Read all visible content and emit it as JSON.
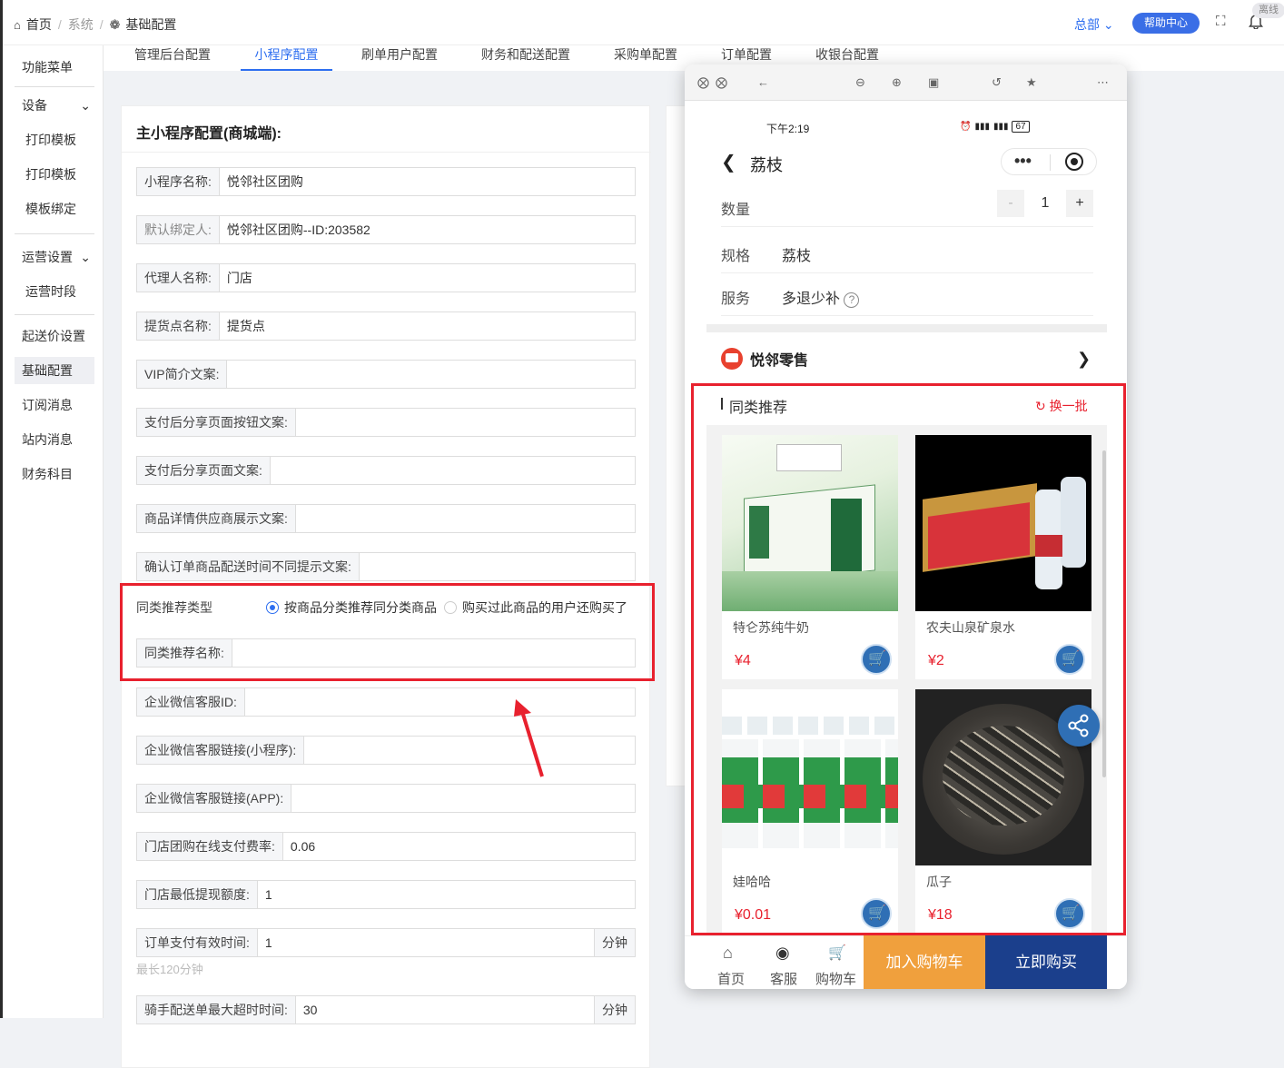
{
  "breadcrumb": {
    "home": "首页",
    "system": "系统",
    "current": "基础配置"
  },
  "header": {
    "branch": "总部",
    "help": "帮助中心",
    "status": "离线"
  },
  "sidebar": {
    "items": [
      {
        "label": "功能菜单"
      },
      {
        "label": "设备"
      },
      {
        "label": "打印模板"
      },
      {
        "label": "打印模板"
      },
      {
        "label": "模板绑定"
      },
      {
        "label": "运营设置"
      },
      {
        "label": "运营时段"
      },
      {
        "label": "起送价设置"
      },
      {
        "label": "基础配置"
      },
      {
        "label": "订阅消息"
      },
      {
        "label": "站内消息"
      },
      {
        "label": "财务科目"
      }
    ]
  },
  "tabs": [
    "管理后台配置",
    "小程序配置",
    "刷单用户配置",
    "财务和配送配置",
    "采购单配置",
    "订单配置",
    "收银台配置"
  ],
  "panel": {
    "title": "主小程序配置(商城端):",
    "fields": [
      {
        "label": "小程序名称:",
        "value": "悦邻社区团购"
      },
      {
        "label": "默认绑定人:",
        "value": "悦邻社区团购--ID:203582"
      },
      {
        "label": "代理人名称:",
        "value": "门店"
      },
      {
        "label": "提货点名称:",
        "value": "提货点"
      },
      {
        "label": "VIP简介文案:",
        "value": ""
      },
      {
        "label": "支付后分享页面按钮文案:",
        "value": ""
      },
      {
        "label": "支付后分享页面文案:",
        "value": ""
      },
      {
        "label": "商品详情供应商展示文案:",
        "value": ""
      },
      {
        "label": "确认订单商品配送时间不同提示文案:",
        "value": ""
      }
    ],
    "rec_type_label": "同类推荐类型",
    "rec_option1": "按商品分类推荐同分类商品",
    "rec_option2": "购买过此商品的用户还购买了",
    "rec_name_label": "同类推荐名称:",
    "fields2": [
      {
        "label": "企业微信客服ID:",
        "value": ""
      },
      {
        "label": "企业微信客服链接(小程序):",
        "value": ""
      },
      {
        "label": "企业微信客服链接(APP):",
        "value": ""
      },
      {
        "label": "门店团购在线支付费率:",
        "value": "0.06"
      },
      {
        "label": "门店最低提现额度:",
        "value": "1"
      },
      {
        "label": "订单支付有效时间:",
        "value": "1",
        "unit": "分钟"
      }
    ],
    "hint": "最长120分钟",
    "last_field": {
      "label": "骑手配送单最大超时时间:",
      "value": "30",
      "unit": "分钟"
    }
  },
  "phone": {
    "time": "下午2:19",
    "battery": "67",
    "title": "荔枝",
    "qty_label": "数量",
    "qty": "1",
    "minus": "-",
    "plus": "+",
    "spec_label": "规格",
    "spec_value": "荔枝",
    "service_label": "服务",
    "service_value": "多退少补",
    "shop_name": "悦邻零售",
    "rec_title": "同类推荐",
    "rec_more": "换一批",
    "products": [
      {
        "name": "特仑苏纯牛奶",
        "price": "¥4"
      },
      {
        "name": "农夫山泉矿泉水",
        "price": "¥2"
      },
      {
        "name": "娃哈哈",
        "price": "¥0.01"
      },
      {
        "name": "瓜子",
        "price": "¥18"
      }
    ],
    "nav": {
      "home": "首页",
      "service": "客服",
      "cart": "购物车"
    },
    "add_cart": "加入购物车",
    "buy_now": "立即购买"
  }
}
